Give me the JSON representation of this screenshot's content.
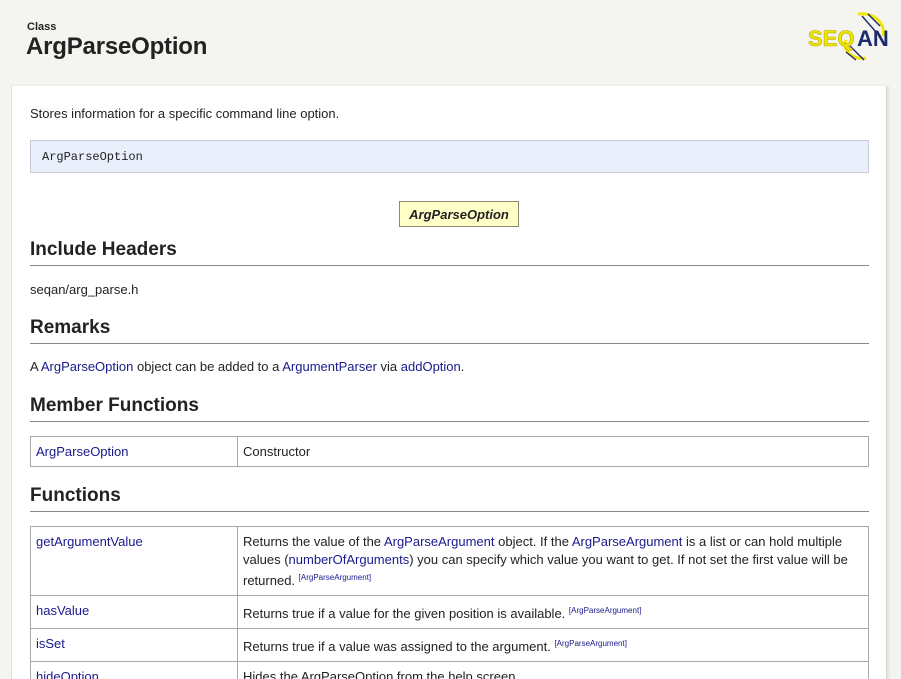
{
  "header": {
    "kind": "Class",
    "title": "ArgParseOption",
    "logo_text": "SEQAN"
  },
  "description": "Stores information for a specific command line option.",
  "signature": "ArgParseOption",
  "diagram_label": "ArgParseOption",
  "include_headers": {
    "heading": "Include Headers",
    "path": "seqan/arg_parse.h"
  },
  "remarks": {
    "heading": "Remarks",
    "pre": "A ",
    "link1": "ArgParseOption",
    "mid1": " object can be added to a ",
    "link2": "ArgumentParser",
    "mid2": " via ",
    "link3": "addOption",
    "post": "."
  },
  "member_functions": {
    "heading": "Member Functions",
    "rows": [
      {
        "name": "ArgParseOption",
        "desc": "Constructor"
      }
    ]
  },
  "functions": {
    "heading": "Functions",
    "rows": [
      {
        "name": "getArgumentValue",
        "t1": "Returns the value of the ",
        "l1": "ArgParseArgument",
        "t2": " object. If the ",
        "l2": "ArgParseArgument",
        "t3": " is a list or can hold multiple values (",
        "l3": "numberOfArguments",
        "t4": ") you can specify which value you want to get. If not set the first value will be returned. ",
        "ref": "[ArgParseArgument]"
      },
      {
        "name": "hasValue",
        "desc": "Returns true if a value for the given position is available. ",
        "ref": "[ArgParseArgument]"
      },
      {
        "name": "isSet",
        "desc": "Returns true if a value was assigned to the argument. ",
        "ref": "[ArgParseArgument]"
      },
      {
        "name": "hideOption",
        "desc": "Hides the ArgParseOption from the help screen."
      }
    ]
  },
  "colors": {
    "link": "#1a1a8c",
    "signature_bg": "#e9eefb",
    "diagram_bg": "#ffffc8",
    "logo_yellow": "#f2e600"
  }
}
